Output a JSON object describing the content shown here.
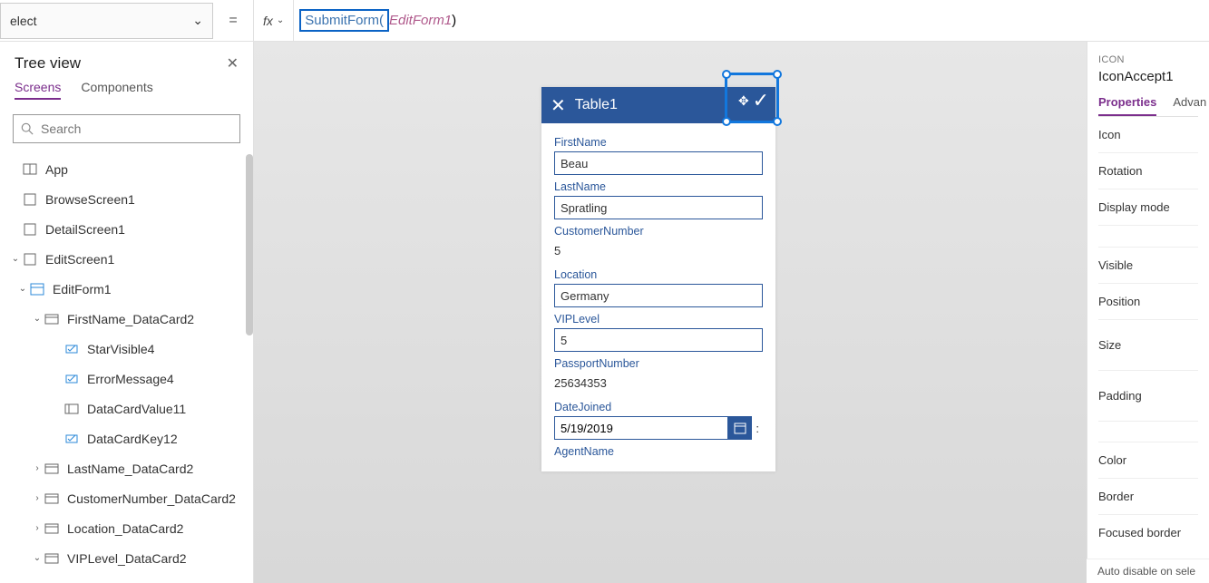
{
  "formula": {
    "property": "elect",
    "equals": "=",
    "fx": "fx",
    "func": "SubmitForm(",
    "arg": "EditForm1",
    "close": ")"
  },
  "treeview": {
    "title": "Tree view",
    "tabs": {
      "screens": "Screens",
      "components": "Components"
    },
    "search_placeholder": "Search",
    "items": {
      "app": "App",
      "browse": "BrowseScreen1",
      "detail": "DetailScreen1",
      "edit": "EditScreen1",
      "editform": "EditForm1",
      "fn_card": "FirstName_DataCard2",
      "star": "StarVisible4",
      "err": "ErrorMessage4",
      "dcv": "DataCardValue11",
      "dck": "DataCardKey12",
      "ln_card": "LastName_DataCard2",
      "cn_card": "CustomerNumber_DataCard2",
      "loc_card": "Location_DataCard2",
      "vip_card": "VIPLevel_DataCard2"
    }
  },
  "app": {
    "title": "Table1",
    "fields": {
      "firstname_l": "FirstName",
      "firstname_v": "Beau",
      "lastname_l": "LastName",
      "lastname_v": "Spratling",
      "custnum_l": "CustomerNumber",
      "custnum_v": "5",
      "location_l": "Location",
      "location_v": "Germany",
      "vip_l": "VIPLevel",
      "vip_v": "5",
      "passport_l": "PassportNumber",
      "passport_v": "25634353",
      "datejoined_l": "DateJoined",
      "datejoined_v": "5/19/2019",
      "agent_l": "AgentName"
    }
  },
  "props": {
    "category": "ICON",
    "name": "IconAccept1",
    "tabs": {
      "properties": "Properties",
      "advanced": "Advan"
    },
    "rows": {
      "icon": "Icon",
      "rotation": "Rotation",
      "display": "Display mode",
      "visible": "Visible",
      "position": "Position",
      "size": "Size",
      "padding": "Padding",
      "color": "Color",
      "border": "Border",
      "focused": "Focused border"
    },
    "footer": "Auto disable on sele"
  }
}
